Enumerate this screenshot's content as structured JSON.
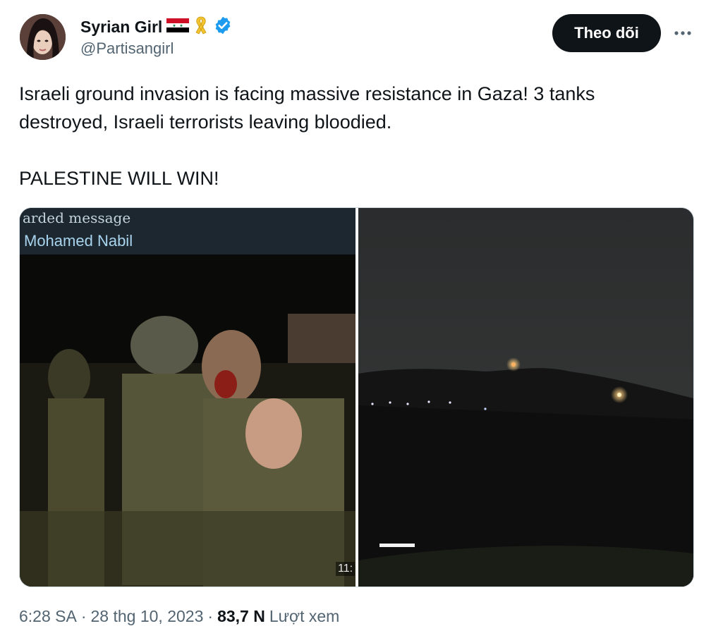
{
  "author": {
    "display_name": "Syrian Girl",
    "handle": "@Partisangirl",
    "verified": true,
    "badges": [
      "syria-flag-icon",
      "yellow-ribbon-icon",
      "verified-badge-icon"
    ]
  },
  "actions": {
    "follow_label": "Theo dõi",
    "more_icon": "more-icon"
  },
  "tweet": {
    "text": "Israeli ground invasion is facing massive resistance in Gaza! 3 tanks destroyed, Israeli terrorists leaving bloodied.\n\nPALESTINE WILL WIN!"
  },
  "media": {
    "left_photo": {
      "forward_text": "arded message",
      "forward_name": "Mohamed Nabil",
      "duration_text": "11:"
    }
  },
  "footer": {
    "time": "6:28 SA",
    "separator1": "·",
    "date": "28 thg 10, 2023",
    "separator2": "·",
    "views_count": "83,7 N",
    "views_label": "Lượt xem"
  },
  "colors": {
    "text_primary": "#0f1419",
    "text_secondary": "#536471",
    "follow_bg": "#0f1419",
    "verified_blue": "#1d9bf0",
    "ribbon_yellow": "#f4c430"
  }
}
